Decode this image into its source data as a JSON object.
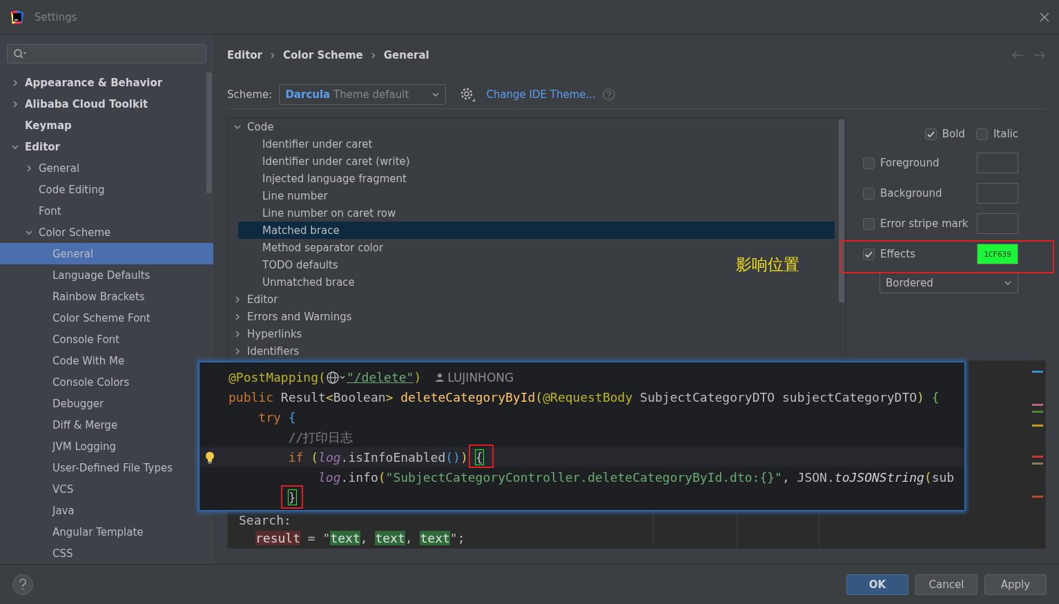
{
  "window": {
    "title": "Settings"
  },
  "sidebar": {
    "items": [
      {
        "label": "Appearance & Behavior",
        "expanded": false,
        "selected": false
      },
      {
        "label": "Alibaba Cloud Toolkit",
        "expanded": false,
        "selected": false
      },
      {
        "label": "Keymap",
        "selected": false
      },
      {
        "label": "Editor",
        "expanded": true,
        "selected": false,
        "children": [
          {
            "label": "General",
            "expanded": false,
            "selected": false
          },
          {
            "label": "Code Editing",
            "selected": false
          },
          {
            "label": "Font",
            "selected": false
          },
          {
            "label": "Color Scheme",
            "expanded": true,
            "selected": false,
            "children": [
              {
                "label": "General",
                "selected": true
              },
              {
                "label": "Language Defaults",
                "selected": false
              },
              {
                "label": "Rainbow Brackets",
                "selected": false
              },
              {
                "label": "Color Scheme Font",
                "selected": false
              },
              {
                "label": "Console Font",
                "selected": false
              },
              {
                "label": "Code With Me",
                "selected": false
              },
              {
                "label": "Console Colors",
                "selected": false
              },
              {
                "label": "Debugger",
                "selected": false
              },
              {
                "label": "Diff & Merge",
                "selected": false
              },
              {
                "label": "JVM Logging",
                "selected": false
              },
              {
                "label": "User-Defined File Types",
                "selected": false
              },
              {
                "label": "VCS",
                "selected": false
              },
              {
                "label": "Java",
                "selected": false
              },
              {
                "label": "Angular Template",
                "selected": false
              },
              {
                "label": "CSS",
                "selected": false
              }
            ]
          }
        ]
      }
    ]
  },
  "breadcrumb": [
    "Editor",
    "Color Scheme",
    "General"
  ],
  "scheme": {
    "label": "Scheme:",
    "name": "Darcula",
    "detail": "Theme default",
    "link": "Change IDE Theme..."
  },
  "attribute_tree": [
    {
      "label": "Code",
      "expanded": true,
      "selected": false,
      "children": [
        {
          "label": "Identifier under caret",
          "selected": false
        },
        {
          "label": "Identifier under caret (write)",
          "selected": false
        },
        {
          "label": "Injected language fragment",
          "selected": false
        },
        {
          "label": "Line number",
          "selected": false
        },
        {
          "label": "Line number on caret row",
          "selected": false
        },
        {
          "label": "Matched brace",
          "selected": true
        },
        {
          "label": "Method separator color",
          "selected": false
        },
        {
          "label": "TODO defaults",
          "selected": false
        },
        {
          "label": "Unmatched brace",
          "selected": false
        }
      ]
    },
    {
      "label": "Editor",
      "expanded": false,
      "selected": false
    },
    {
      "label": "Errors and Warnings",
      "expanded": false,
      "selected": false
    },
    {
      "label": "Hyperlinks",
      "expanded": false,
      "selected": false
    },
    {
      "label": "Identifiers",
      "expanded": false,
      "selected": false
    }
  ],
  "font_style": [
    {
      "label": "Bold",
      "checked": true
    },
    {
      "label": "Italic",
      "checked": false
    }
  ],
  "attributes": [
    {
      "label": "Foreground",
      "checked": false
    },
    {
      "label": "Background",
      "checked": false
    },
    {
      "label": "Error stripe mark",
      "checked": false
    },
    {
      "label": "Effects",
      "checked": true,
      "swatch": "1CF639",
      "color": "#1cf639"
    }
  ],
  "effect_type": "Bordered",
  "preview": {
    "label": "Search:",
    "tokens": [
      {
        "kind": "var",
        "text": "result"
      },
      {
        "kind": "plain",
        "text": " = \""
      },
      {
        "kind": "match",
        "text": "text"
      },
      {
        "kind": "plain",
        "text": ", "
      },
      {
        "kind": "match",
        "text": "text"
      },
      {
        "kind": "plain",
        "text": ", "
      },
      {
        "kind": "match",
        "text": "text"
      },
      {
        "kind": "plain",
        "text": "\";"
      }
    ]
  },
  "code_popup": {
    "lines": [
      {
        "caret_row": false,
        "tokens": [
          {
            "kind": "annotation",
            "text": "@PostMapping("
          },
          {
            "kind": "globe"
          },
          {
            "kind": "link",
            "text": "\"/delete\""
          },
          {
            "kind": "annotation",
            "text": ")"
          },
          {
            "kind": "author",
            "text": "LUJINHONG"
          }
        ]
      },
      {
        "caret_row": false,
        "tokens": [
          {
            "kind": "keyword",
            "text": "public "
          },
          {
            "kind": "plain",
            "text": "Result"
          },
          {
            "kind": "bracket",
            "text": "<"
          },
          {
            "kind": "plain",
            "text": "Boolean"
          },
          {
            "kind": "bracket",
            "text": "> "
          },
          {
            "kind": "method",
            "text": "deleteCategoryById"
          },
          {
            "kind": "bracket",
            "text": "("
          },
          {
            "kind": "annotation",
            "text": "@RequestBody "
          },
          {
            "kind": "plain",
            "text": "SubjectCategoryDTO subjectCategoryDTO"
          },
          {
            "kind": "bracket",
            "text": ") "
          },
          {
            "kind": "rainbow",
            "text": "{"
          }
        ],
        "children": [
          {
            "caret_row": false,
            "tokens": [
              {
                "kind": "keyword",
                "text": "try "
              },
              {
                "kind": "rainbow2",
                "text": "{"
              }
            ],
            "children": [
              {
                "caret_row": false,
                "tokens": [
                  {
                    "kind": "comment",
                    "text": "//打印日志"
                  }
                ]
              },
              {
                "caret_row": true,
                "tokens": [
                  {
                    "kind": "keyword",
                    "text": "if "
                  },
                  {
                    "kind": "bracket",
                    "text": "("
                  },
                  {
                    "kind": "field",
                    "text": "log"
                  },
                  {
                    "kind": "plain",
                    "text": ".isInfoEnabled"
                  },
                  {
                    "kind": "rainbow2",
                    "text": "()"
                  },
                  {
                    "kind": "bracket",
                    "text": ") "
                  },
                  {
                    "kind": "brace",
                    "text": "{"
                  }
                ],
                "children": [
                  {
                    "caret_row": false,
                    "tokens": [
                      {
                        "kind": "field",
                        "text": "log"
                      },
                      {
                        "kind": "plain",
                        "text": ".info"
                      },
                      {
                        "kind": "bracket",
                        "text": "("
                      },
                      {
                        "kind": "string",
                        "text": "\"SubjectCategoryController.deleteCategoryById.dto:{}\""
                      },
                      {
                        "kind": "plain",
                        "text": ", JSON."
                      },
                      {
                        "kind": "static",
                        "text": "toJSONString"
                      },
                      {
                        "kind": "bracket",
                        "text": "("
                      },
                      {
                        "kind": "plain",
                        "text": "sub"
                      }
                    ]
                  }
                ]
              },
              {
                "caret_row": false,
                "tokens": [
                  {
                    "kind": "brace",
                    "text": "}"
                  }
                ]
              }
            ]
          }
        ]
      }
    ]
  },
  "annotation": {
    "note": "影响位置"
  },
  "buttons": [
    {
      "label": "OK",
      "kind": "primary"
    },
    {
      "label": "Cancel",
      "kind": "secondary"
    },
    {
      "label": "Apply",
      "kind": "secondary"
    }
  ]
}
